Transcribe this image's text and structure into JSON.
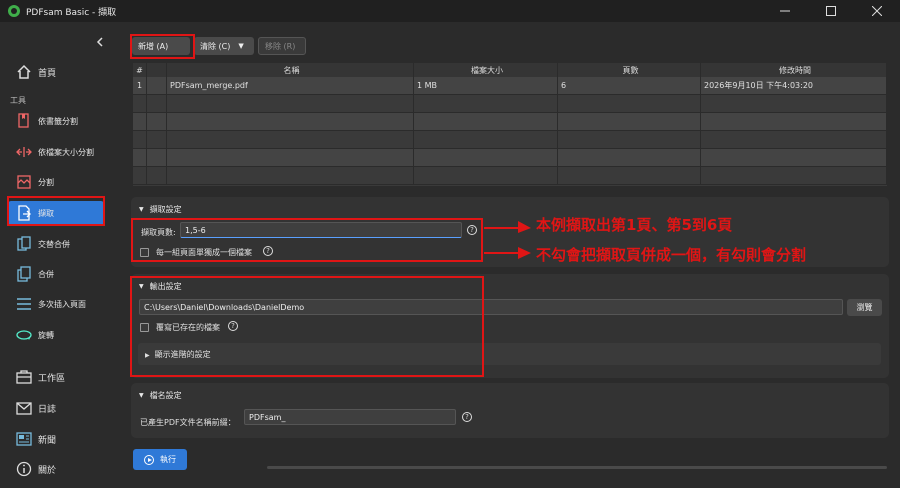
{
  "window": {
    "title": "PDFsam Basic - 擷取",
    "controls": [
      "minimize",
      "maximize",
      "close"
    ]
  },
  "sidebar": {
    "collapse_icon": "chevron-left-icon",
    "home": {
      "label": "首頁",
      "icon": "home-icon"
    },
    "section_label": "工具",
    "items": [
      {
        "label": "依書籤分割",
        "icon": "bookmark-split-icon"
      },
      {
        "label": "依檔案大小分割",
        "icon": "size-split-icon"
      },
      {
        "label": "分割",
        "icon": "split-icon"
      },
      {
        "label": "擷取",
        "icon": "extract-icon",
        "active": true
      },
      {
        "label": "交替合併",
        "icon": "alternate-mix-icon"
      },
      {
        "label": "合併",
        "icon": "merge-icon"
      },
      {
        "label": "多次插入頁面",
        "icon": "insert-pages-icon"
      },
      {
        "label": "旋轉",
        "icon": "rotate-icon"
      }
    ],
    "bottom": [
      {
        "label": "工作區",
        "icon": "workspace-icon"
      },
      {
        "label": "日誌",
        "icon": "log-icon"
      },
      {
        "label": "新聞",
        "icon": "news-icon"
      },
      {
        "label": "關於",
        "icon": "info-icon"
      }
    ]
  },
  "toolbar": {
    "add_label": "新增 (A)",
    "clear_label": "清除 (C)",
    "remove_label": "移除 (R)"
  },
  "table": {
    "headers": [
      "#",
      "",
      "名稱",
      "檔案大小",
      "頁數",
      "修改時間"
    ],
    "rows": [
      {
        "num": "1",
        "name": "PDFsam_merge.pdf",
        "size": "1 MB",
        "pages": "6",
        "modified": "2026年9月10日 下午4:03:20"
      }
    ]
  },
  "extract_settings": {
    "title": "擷取設定",
    "pages_label": "擷取頁數:",
    "pages_value": "1,5-6",
    "separate_file_label": "每一組頁面單獨成一個檔案",
    "separate_file_checked": false
  },
  "output_settings": {
    "title": "輸出設定",
    "path_value": "C:\\Users\\Daniel\\Downloads\\DanielDemo",
    "browse_label": "瀏覽",
    "overwrite_label": "覆寫已存在的檔案",
    "overwrite_checked": false,
    "advanced_label": "顯示進階的設定"
  },
  "filename_settings": {
    "title": "檔名設定",
    "prefix_label": "已產生PDF文件名稱前綴：",
    "prefix_value": "PDFsam_"
  },
  "run": {
    "label": "執行"
  },
  "annotations": {
    "note1": "本例擷取出第1頁、第5到6頁",
    "note2": "不勾會把擷取頁併成一個，有勾則會分割",
    "color": "#e01515"
  }
}
